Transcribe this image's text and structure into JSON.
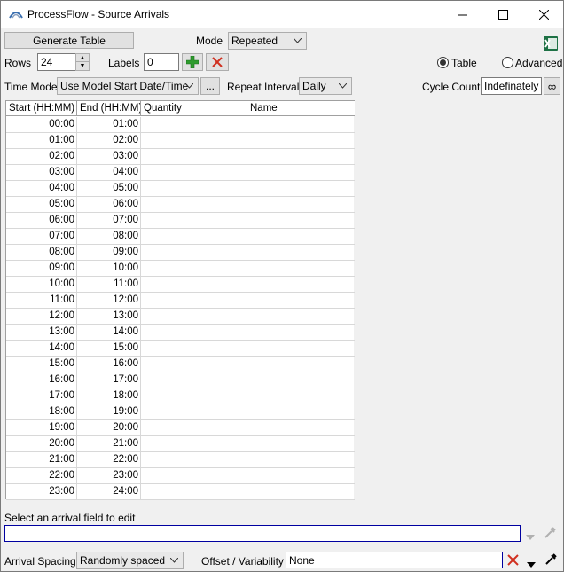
{
  "window": {
    "title": "ProcessFlow - Source Arrivals"
  },
  "toolbar": {
    "generate_table": "Generate Table",
    "mode_label": "Mode",
    "mode_value": "Repeated",
    "rows_label": "Rows",
    "rows_value": "24",
    "labels_label": "Labels",
    "labels_value": "0",
    "view_table": "Table",
    "view_advanced": "Advanced",
    "time_mode_label": "Time Mode",
    "time_mode_value": "Use Model Start Date/Time",
    "ellipsis": "...",
    "repeat_interval_label": "Repeat Interval",
    "repeat_interval_value": "Daily",
    "cycle_count_label": "Cycle Count",
    "cycle_count_value": "Indefinately",
    "infinity": "∞"
  },
  "table": {
    "headers": [
      "Start (HH:MM)",
      "End (HH:MM)",
      "Quantity",
      "Name"
    ],
    "rows": [
      [
        "00:00",
        "01:00",
        "",
        ""
      ],
      [
        "01:00",
        "02:00",
        "",
        ""
      ],
      [
        "02:00",
        "03:00",
        "",
        ""
      ],
      [
        "03:00",
        "04:00",
        "",
        ""
      ],
      [
        "04:00",
        "05:00",
        "",
        ""
      ],
      [
        "05:00",
        "06:00",
        "",
        ""
      ],
      [
        "06:00",
        "07:00",
        "",
        ""
      ],
      [
        "07:00",
        "08:00",
        "",
        ""
      ],
      [
        "08:00",
        "09:00",
        "",
        ""
      ],
      [
        "09:00",
        "10:00",
        "",
        ""
      ],
      [
        "10:00",
        "11:00",
        "",
        ""
      ],
      [
        "11:00",
        "12:00",
        "",
        ""
      ],
      [
        "12:00",
        "13:00",
        "",
        ""
      ],
      [
        "13:00",
        "14:00",
        "",
        ""
      ],
      [
        "14:00",
        "15:00",
        "",
        ""
      ],
      [
        "15:00",
        "16:00",
        "",
        ""
      ],
      [
        "16:00",
        "17:00",
        "",
        ""
      ],
      [
        "17:00",
        "18:00",
        "",
        ""
      ],
      [
        "18:00",
        "19:00",
        "",
        ""
      ],
      [
        "19:00",
        "20:00",
        "",
        ""
      ],
      [
        "20:00",
        "21:00",
        "",
        ""
      ],
      [
        "21:00",
        "22:00",
        "",
        ""
      ],
      [
        "22:00",
        "23:00",
        "",
        ""
      ],
      [
        "23:00",
        "24:00",
        "",
        ""
      ]
    ]
  },
  "bottom": {
    "select_hint": "Select an arrival field to edit",
    "field_value": "",
    "arrival_spacing_label": "Arrival Spacing",
    "arrival_spacing_value": "Randomly spaced",
    "offset_label": "Offset / Variability",
    "offset_value": "None"
  },
  "colors": {
    "accent_border": "#0000a0",
    "add_green": "#2e9b2e",
    "delete_red": "#d03020",
    "excel_green": "#1e7145"
  }
}
